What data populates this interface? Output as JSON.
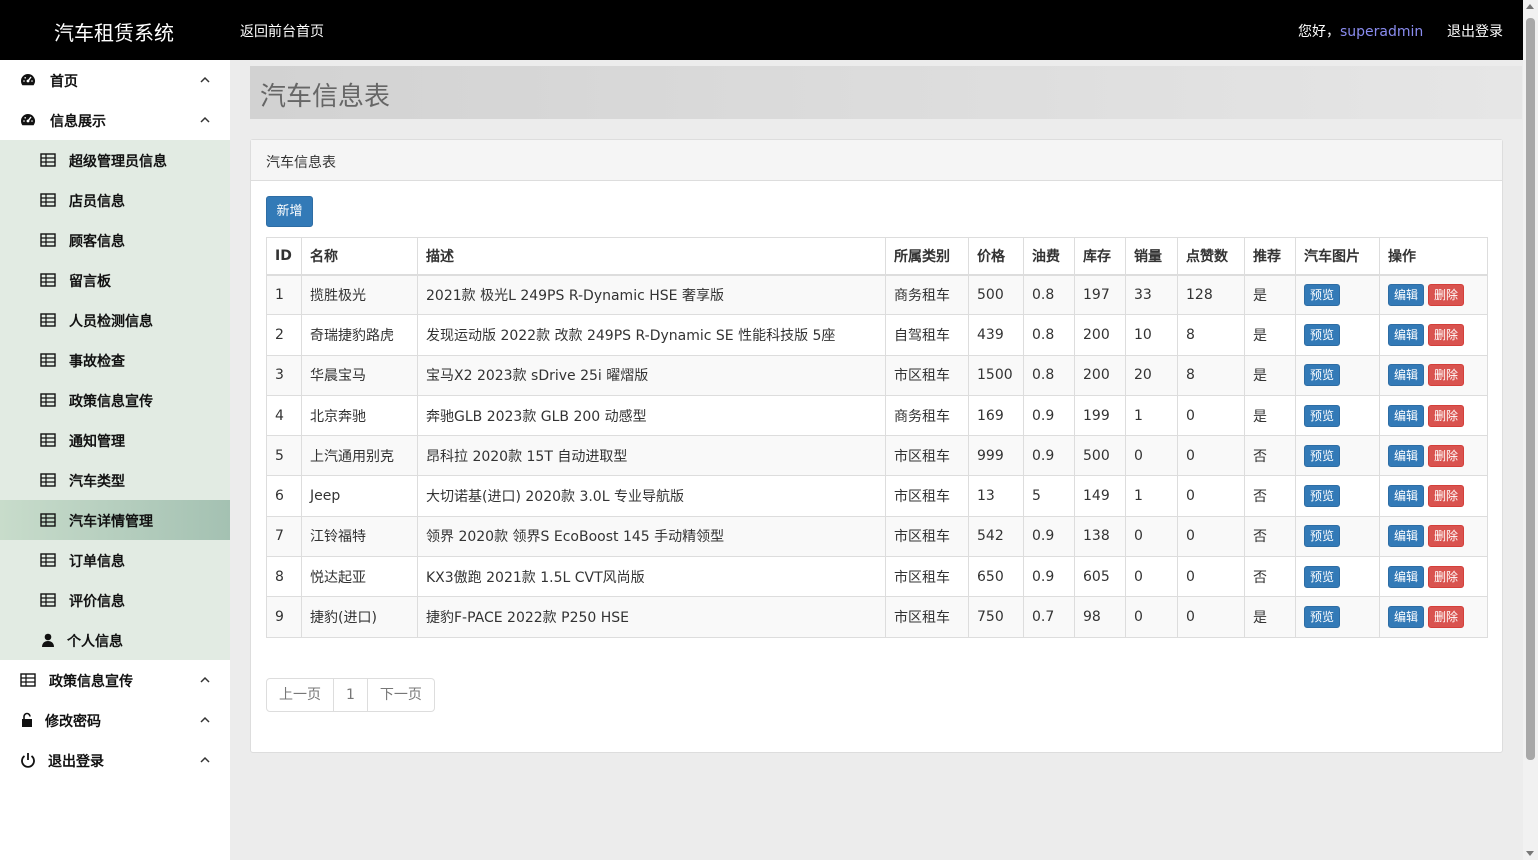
{
  "header": {
    "brand": "汽车租赁系统",
    "back_link": "返回前台首页",
    "greeting": "您好，",
    "username": "superadmin",
    "logout": "退出登录"
  },
  "sidebar": {
    "home": "首页",
    "info_display": "信息展示",
    "sub_items": [
      "超级管理员信息",
      "店员信息",
      "顾客信息",
      "留言板",
      "人员检测信息",
      "事故检查",
      "政策信息宣传",
      "通知管理",
      "汽车类型",
      "汽车详情管理",
      "订单信息",
      "评价信息",
      "个人信息"
    ],
    "active_item": "汽车详情管理",
    "policy": "政策信息宣传",
    "change_password": "修改密码",
    "logout": "退出登录"
  },
  "page": {
    "title": "汽车信息表",
    "panel_title": "汽车信息表",
    "add_button": "新增"
  },
  "table": {
    "headers": [
      "ID",
      "名称",
      "描述",
      "所属类别",
      "价格",
      "油费",
      "库存",
      "销量",
      "点赞数",
      "推荐",
      "汽车图片",
      "操作"
    ],
    "preview_label": "预览",
    "edit_label": "编辑",
    "delete_label": "删除",
    "rows": [
      [
        "1",
        "揽胜极光",
        "2021款 极光L 249PS R-Dynamic HSE 奢享版",
        "商务租车",
        "500",
        "0.8",
        "197",
        "33",
        "128",
        "是"
      ],
      [
        "2",
        "奇瑞捷豹路虎",
        "发现运动版 2022款 改款 249PS R-Dynamic SE 性能科技版 5座",
        "自驾租车",
        "439",
        "0.8",
        "200",
        "10",
        "8",
        "是"
      ],
      [
        "3",
        "华晨宝马",
        "宝马X2 2023款 sDrive 25i 曜熠版",
        "市区租车",
        "1500",
        "0.8",
        "200",
        "20",
        "8",
        "是"
      ],
      [
        "4",
        "北京奔驰",
        "奔驰GLB 2023款 GLB 200 动感型",
        "商务租车",
        "169",
        "0.9",
        "199",
        "1",
        "0",
        "是"
      ],
      [
        "5",
        "上汽通用别克",
        "昂科拉 2020款 15T 自动进取型",
        "市区租车",
        "999",
        "0.9",
        "500",
        "0",
        "0",
        "否"
      ],
      [
        "6",
        "Jeep",
        "大切诺基(进口) 2020款 3.0L 专业导航版",
        "市区租车",
        "13",
        "5",
        "149",
        "1",
        "0",
        "否"
      ],
      [
        "7",
        "江铃福特",
        "领界 2020款 领界S EcoBoost 145 手动精领型",
        "市区租车",
        "542",
        "0.9",
        "138",
        "0",
        "0",
        "否"
      ],
      [
        "8",
        "悦达起亚",
        "KX3傲跑 2021款 1.5L CVT风尚版",
        "市区租车",
        "650",
        "0.9",
        "605",
        "0",
        "0",
        "否"
      ],
      [
        "9",
        "捷豹(进口)",
        "捷豹F-PACE 2022款 P250 HSE",
        "市区租车",
        "750",
        "0.7",
        "98",
        "0",
        "0",
        "是"
      ]
    ]
  },
  "pagination": {
    "prev": "上一页",
    "current": "1",
    "next": "下一页"
  }
}
